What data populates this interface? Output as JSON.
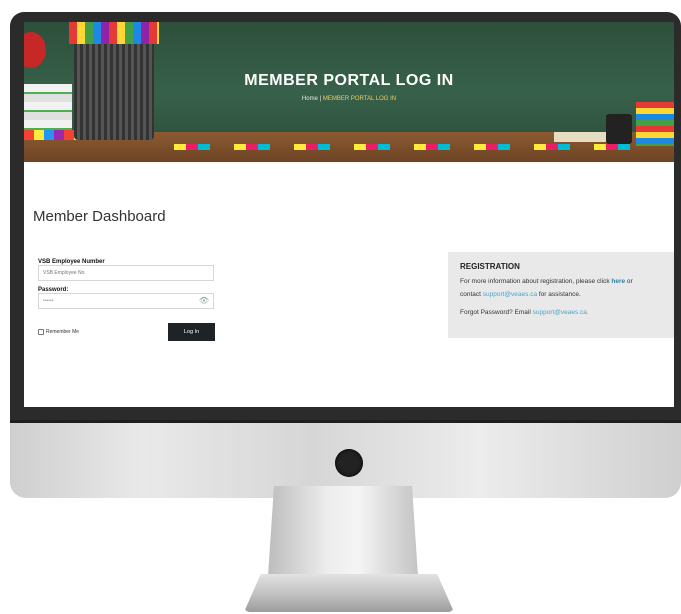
{
  "hero": {
    "title": "MEMBER PORTAL LOG IN",
    "breadcrumb_home": "Home",
    "breadcrumb_sep": "|",
    "breadcrumb_current": "MEMBER PORTAL LOG IN"
  },
  "main": {
    "title": "Member Dashboard"
  },
  "login": {
    "employee_label": "VSB Employee Number",
    "employee_placeholder": "VSB Employee No.",
    "password_label": "Password:",
    "password_value": "••••••",
    "remember_label": "Remember Me",
    "login_button": "Log In"
  },
  "registration": {
    "title": "REGISTRATION",
    "line1_pre": "For more information about registration, please click ",
    "line1_link": "here",
    "line1_post": " or",
    "line2_pre": "contact ",
    "line2_email": "support@veaes.ca",
    "line2_post": " for assistance.",
    "forgot_pre": "Forgot Password? Email ",
    "forgot_email": "support@veaes.ca."
  },
  "icons": {
    "eye": "eye-icon"
  },
  "colors": {
    "hero_green": "#37614a",
    "button_dark": "#1d2327",
    "link": "#4aa6c9",
    "panel_bg": "#e9e9e9"
  }
}
